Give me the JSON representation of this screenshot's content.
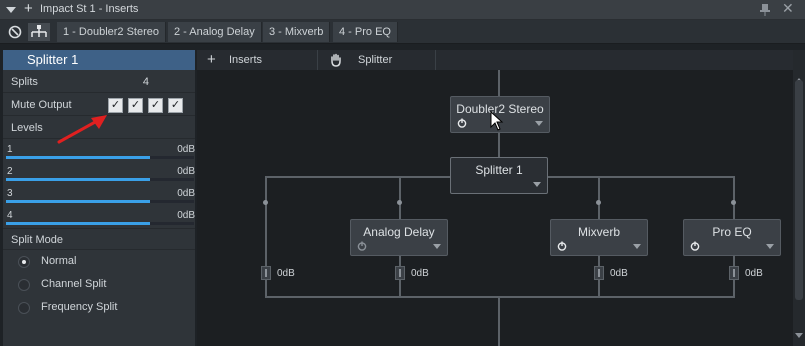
{
  "window": {
    "title": "Impact St 1 - Inserts"
  },
  "tabs": [
    {
      "label": "1 - Doubler2 Stereo"
    },
    {
      "label": "2 - Analog Delay"
    },
    {
      "label": "3 - Mixverb"
    },
    {
      "label": "4 - Pro EQ"
    }
  ],
  "left_panel": {
    "header": "Splitter 1",
    "splits_label": "Splits",
    "splits_value": "4",
    "mute_output_label": "Mute Output",
    "mute_checks": [
      "✓",
      "✓",
      "✓",
      "✓"
    ],
    "levels_label": "Levels",
    "levels": [
      {
        "num": "1",
        "value": "0dB"
      },
      {
        "num": "2",
        "value": "0dB"
      },
      {
        "num": "3",
        "value": "0dB"
      },
      {
        "num": "4",
        "value": "0dB"
      }
    ],
    "split_mode_label": "Split Mode",
    "split_modes": [
      {
        "label": "Normal",
        "selected": true
      },
      {
        "label": "Channel Split",
        "selected": false
      },
      {
        "label": "Frequency Split",
        "selected": false
      }
    ]
  },
  "toolbar": {
    "inserts_label": "Inserts",
    "splitter_label": "Splitter"
  },
  "routing": {
    "doubler": "Doubler2 Stereo",
    "splitter": "Splitter 1",
    "branches": [
      {
        "name": "",
        "db": "0dB"
      },
      {
        "name": "Analog Delay",
        "db": "0dB"
      },
      {
        "name": "Mixverb",
        "db": "0dB"
      },
      {
        "name": "Pro EQ",
        "db": "0dB"
      }
    ]
  },
  "colors": {
    "accent": "#3e6187",
    "level_bar": "#3aa0e8",
    "annotation_arrow": "#e02020"
  }
}
